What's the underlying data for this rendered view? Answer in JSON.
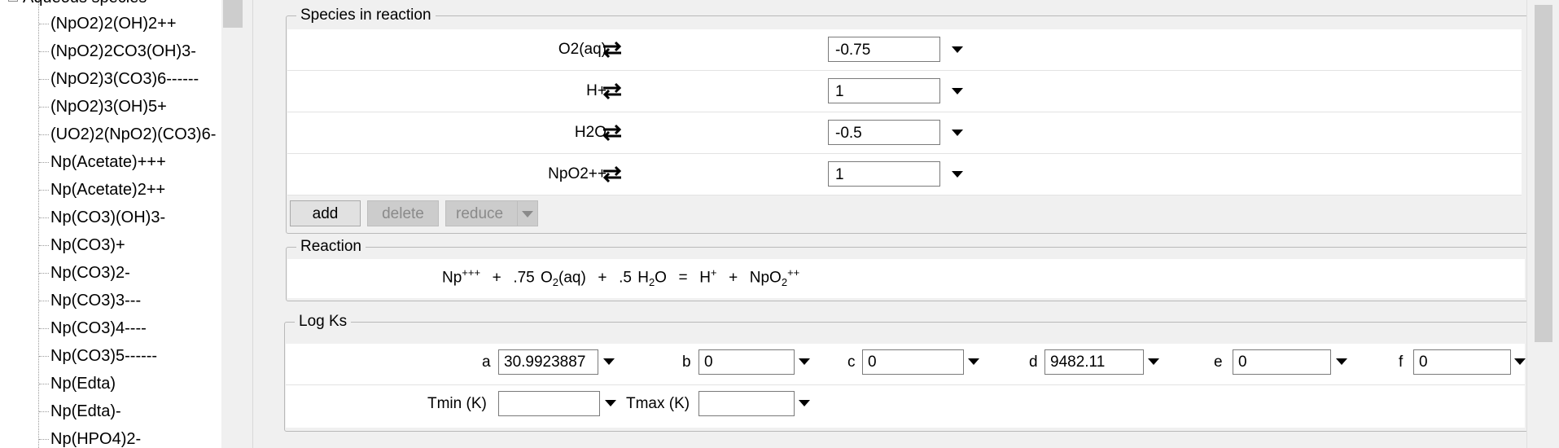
{
  "tree": {
    "header_label": "Aqueous species",
    "items": [
      "(NpO2)2(OH)2++",
      "(NpO2)2CO3(OH)3-",
      "(NpO2)3(CO3)6------",
      "(NpO2)3(OH)5+",
      "(UO2)2(NpO2)(CO3)6-",
      "Np(Acetate)+++",
      "Np(Acetate)2++",
      "Np(CO3)(OH)3-",
      "Np(CO3)+",
      "Np(CO3)2-",
      "Np(CO3)3---",
      "Np(CO3)4----",
      "Np(CO3)5------",
      "Np(Edta)",
      "Np(Edta)-",
      "Np(HPO4)2-"
    ]
  },
  "species_group": {
    "title": "Species in reaction",
    "rows": [
      {
        "name": "O2(aq)",
        "coef": "-0.75"
      },
      {
        "name": "H+",
        "coef": "1"
      },
      {
        "name": "H2O",
        "coef": "-0.5"
      },
      {
        "name": "NpO2++",
        "coef": "1"
      }
    ],
    "add_label": "add",
    "delete_label": "delete",
    "reduce_label": "reduce"
  },
  "reaction_group": {
    "title": "Reaction",
    "terms": {
      "t1": "Np",
      "t1_sup": "+++",
      "plus1": "+",
      "t2_coef": ".75",
      "t2": "O",
      "t2_sub": "2",
      "t2_rest": "(aq)",
      "plus2": "+",
      "t3_coef": ".5",
      "t3": "H",
      "t3_sub": "2",
      "t3_rest": "O",
      "eq": "=",
      "t4": "H",
      "t4_sup": "+",
      "plus3": "+",
      "t5": "NpO",
      "t5_sub": "2",
      "t5_sup": "++"
    }
  },
  "logk_group": {
    "title": "Log Ks",
    "a_label": "a",
    "a_value": "30.9923887",
    "b_label": "b",
    "b_value": "0",
    "c_label": "c",
    "c_value": "0",
    "d_label": "d",
    "d_value": "9482.11",
    "e_label": "e",
    "e_value": "0",
    "f_label": "f",
    "f_value": "0",
    "tmin_label": "Tmin (K)",
    "tmin_value": "",
    "tmax_label": "Tmax (K)",
    "tmax_value": ""
  }
}
